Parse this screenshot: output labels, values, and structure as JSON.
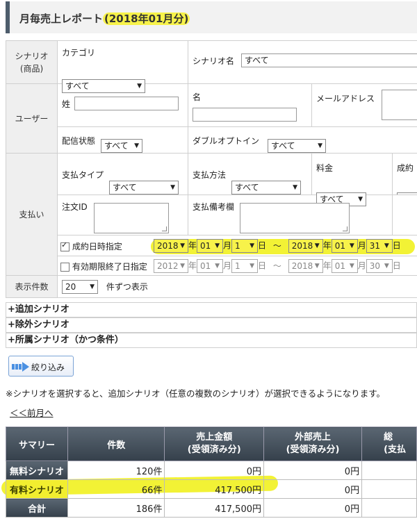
{
  "report": {
    "title_prefix": "月毎売上レポート",
    "title_period": "(2018年01月分)"
  },
  "filters": {
    "scenario": {
      "label": "シナリオ\n(商品)",
      "category_label": "カテゴリ",
      "category_value": "すべて",
      "name_label": "シナリオ名",
      "name_value": "すべて"
    },
    "user": {
      "label": "ユーザー",
      "last_name_label": "姓",
      "first_name_label": "名",
      "email_label": "メールアドレス",
      "delivery_label": "配信状態",
      "delivery_value": "すべて",
      "double_optin_label": "ダブルオプトイン",
      "double_optin_value": "すべて"
    },
    "payment": {
      "label": "支払い",
      "type_label": "支払タイプ",
      "type_value": "すべて",
      "method_label": "支払方法",
      "method_value": "すべて",
      "fee_label": "料金",
      "fee_value": "すべて",
      "success_col_label": "成約",
      "success_col_value": "すべ",
      "order_id_label": "注文ID",
      "memo_label": "支払備考欄",
      "date_filter": {
        "label": "成約日時指定",
        "checked": true,
        "from_year": "2018",
        "from_month": "01",
        "from_day": "1",
        "to_year": "2018",
        "to_month": "01",
        "to_day": "31",
        "unit_year": "年",
        "unit_month": "月",
        "unit_day": "日",
        "tilde": "～"
      },
      "expiry_filter": {
        "label": "有効期限終了日指定",
        "checked": false,
        "from_year": "2012",
        "from_month": "01",
        "from_day": "1",
        "to_year": "2018",
        "to_month": "01",
        "to_day": "30"
      }
    },
    "display": {
      "label": "表示件数",
      "count_value": "20",
      "suffix": "件ずつ表示"
    },
    "expanders": [
      "+追加シナリオ",
      "+除外シナリオ",
      "+所属シナリオ（かつ条件）"
    ],
    "narrow_button": "絞り込み",
    "note": "※シナリオを選択すると、追加シナリオ（任意の複数のシナリオ）が選択できるようになります。",
    "prev_month": "＜＜前月へ"
  },
  "summary": {
    "headers": [
      "サマリー",
      "件数",
      "売上金額\n(受領済み分)",
      "外部売上\n(受領済み分)",
      "総\n(支払"
    ],
    "rows": [
      {
        "label": "無料シナリオ",
        "count": "120件",
        "sales": "0円",
        "external": "0円"
      },
      {
        "label": "有料シナリオ",
        "count": "66件",
        "sales": "417,500円",
        "external": "0円"
      },
      {
        "label": "合計",
        "count": "186件",
        "sales": "417,500円",
        "external": "0円"
      }
    ]
  },
  "colors": {
    "highlight": "#f7f24a",
    "header_dark": "#3f4a55",
    "label_bg": "#efefef"
  }
}
